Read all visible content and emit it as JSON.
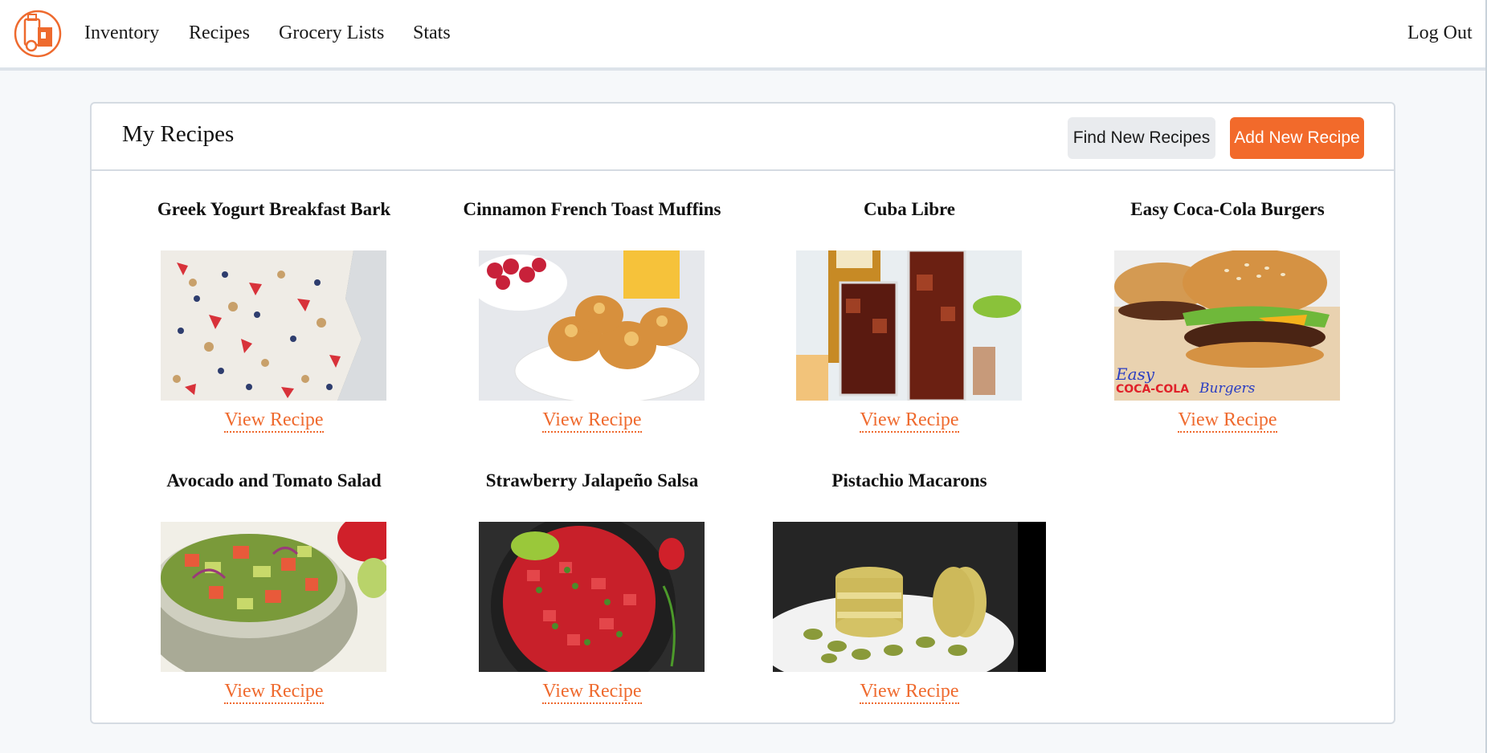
{
  "nav": {
    "logo_icon": "grocery-bag-logo-icon",
    "links": [
      "Inventory",
      "Recipes",
      "Grocery Lists",
      "Stats"
    ],
    "logout": "Log Out"
  },
  "page": {
    "title": "My Recipes",
    "find_button": "Find New Recipes",
    "add_button": "Add New Recipe"
  },
  "colors": {
    "accent": "#f26a2b",
    "background": "#f6f8fa",
    "card_border": "#d5dbe2"
  },
  "recipes": [
    {
      "title": "Greek Yogurt Breakfast Bark",
      "link": "View Recipe"
    },
    {
      "title": "Cinnamon French Toast Muffins",
      "link": "View Recipe"
    },
    {
      "title": "Cuba Libre",
      "link": "View Recipe"
    },
    {
      "title": "Easy Coca-Cola Burgers",
      "link": "View Recipe",
      "image_caption": [
        "Easy",
        "COCA-COLA",
        "Burgers"
      ]
    },
    {
      "title": "Avocado and Tomato Salad",
      "link": "View Recipe"
    },
    {
      "title": "Strawberry Jalapeño Salsa",
      "link": "View Recipe"
    },
    {
      "title": "Pistachio Macarons",
      "link": "View Recipe"
    }
  ]
}
